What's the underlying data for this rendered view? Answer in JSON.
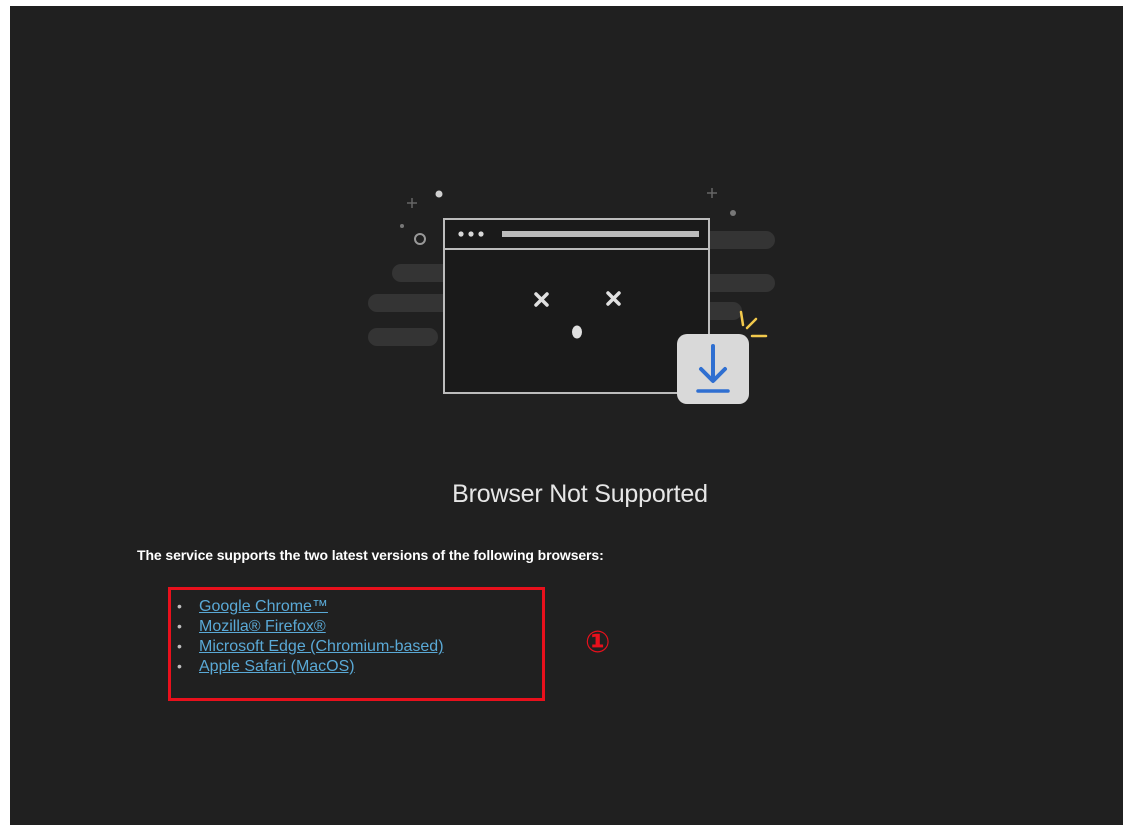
{
  "page": {
    "title": "Browser Not Supported",
    "message": "The service supports the two latest versions of the following browsers:"
  },
  "browsers": [
    {
      "bullet": "•",
      "label": "Google Chrome™"
    },
    {
      "bullet": "•",
      "label": "Mozilla® Firefox®"
    },
    {
      "bullet": "•",
      "label": "Microsoft Edge (Chromium-based)"
    },
    {
      "bullet": "•",
      "label": "Apple Safari (MacOS)"
    }
  ],
  "annotation": {
    "marker": "①"
  },
  "colors": {
    "background": "#202020",
    "link": "#5aa9d6",
    "annotation": "#e8101c",
    "download_arrow": "#2f6fd1",
    "sparkle": "#f2c94c"
  },
  "icons": {
    "illustration": "broken-browser-window-icon",
    "download": "download-icon"
  }
}
